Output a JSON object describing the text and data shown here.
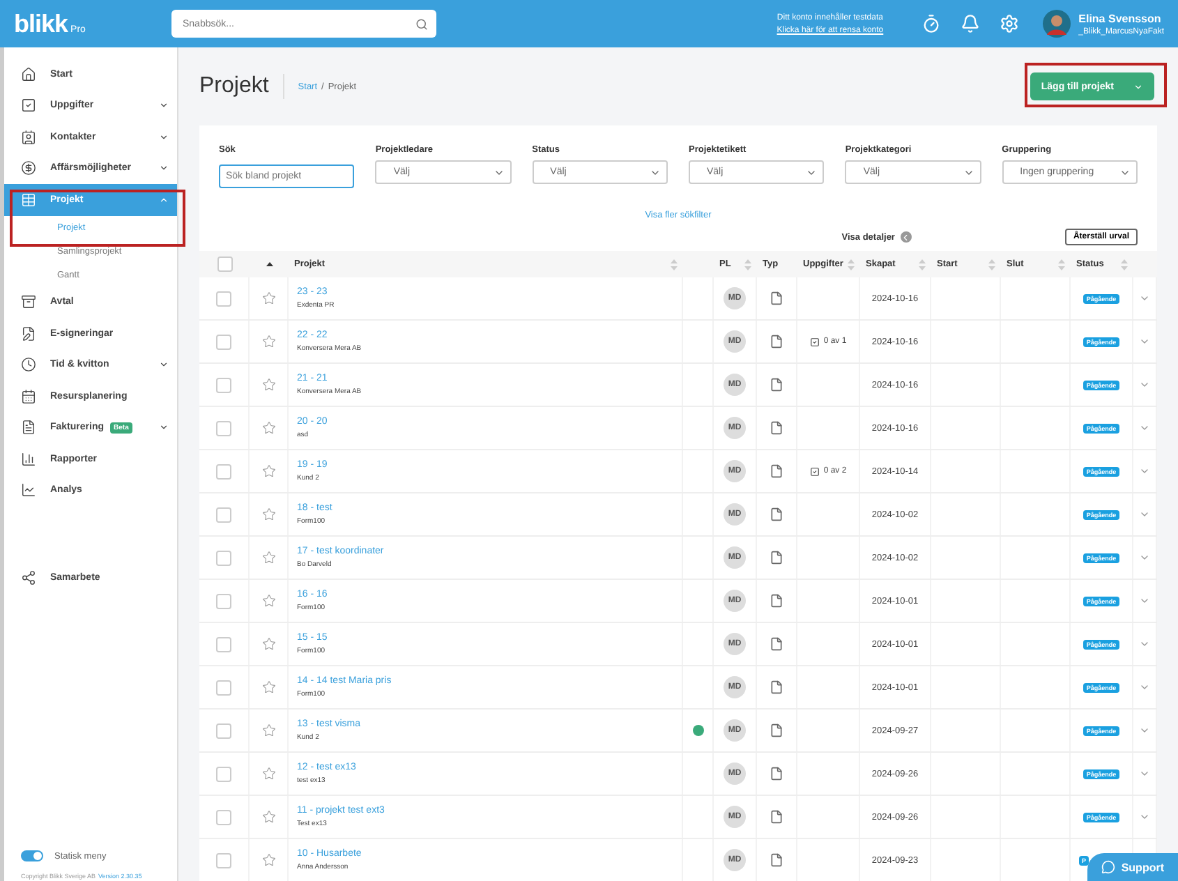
{
  "topbar": {
    "logo": "blikk",
    "logo_suffix": "Pro",
    "search": {
      "placeholder": "Snabbsök..."
    },
    "notice": "Ditt konto innehåller testdata",
    "notice_link": "Klicka här för att rensa konto",
    "user_name": "Elina Svensson",
    "user_account": "_Blikk_MarcusNyaFakt"
  },
  "sidebar": {
    "items": [
      {
        "label": "Start"
      },
      {
        "label": "Uppgifter",
        "expanded": false
      },
      {
        "label": "Kontakter",
        "expanded": false
      },
      {
        "label": "Affärsmöjligheter",
        "expanded": false
      },
      {
        "label": "Projekt",
        "expanded": true,
        "selected": true,
        "children": [
          {
            "label": "Projekt",
            "selected": true
          },
          {
            "label": "Samlingsprojekt",
            "selected": false
          },
          {
            "label": "Gantt",
            "selected": false
          }
        ]
      },
      {
        "label": "Avtal"
      },
      {
        "label": "E-signeringar"
      },
      {
        "label": "Tid & kvitton",
        "expanded": false
      },
      {
        "label": "Resursplanering"
      },
      {
        "label": "Fakturering",
        "badge": "Beta",
        "expanded": false
      },
      {
        "label": "Rapporter"
      },
      {
        "label": "Analys"
      }
    ],
    "bottom_items": [
      {
        "label": "Samarbete"
      }
    ],
    "toggle": {
      "label": "Statisk meny",
      "on": true
    },
    "footer": "Copyright Blikk Sverige AB",
    "version": "Version 2.30.35"
  },
  "page": {
    "title": "Projekt",
    "breadcrumb": [
      "Start",
      "Projekt"
    ],
    "breadcrumb_separator": "/",
    "add_button": "Lägg till projekt"
  },
  "filters": [
    {
      "label": "Sök",
      "kind": "text",
      "placeholder": "Sök bland projekt"
    },
    {
      "label": "Projektledare",
      "kind": "select",
      "value": "Välj"
    },
    {
      "label": "Status",
      "kind": "select",
      "value": "Välj"
    },
    {
      "label": "Projektetikett",
      "kind": "select",
      "value": "Välj"
    },
    {
      "label": "Projektkategori",
      "kind": "select",
      "value": "Välj"
    },
    {
      "label": "Gruppering",
      "kind": "select",
      "value": "Ingen gruppering"
    }
  ],
  "more_filters": "Visa fler sökfilter",
  "show_details": "Visa detaljer",
  "reset_button": "Återställ urval",
  "table": {
    "select_all_checked": false,
    "columns": [
      "Projekt",
      "PL",
      "Typ",
      "Uppgifter",
      "Skapat",
      "Start",
      "Slut",
      "Status"
    ],
    "rows": [
      {
        "checked": false,
        "name": "23 - 23",
        "client": "Exdenta PR",
        "pl": "MD",
        "created": "2024-10-16",
        "status": "Pågående"
      },
      {
        "checked": false,
        "name": "22 - 22",
        "client": "Konversera Mera AB",
        "pl": "MD",
        "tasks": "0 av 1",
        "created": "2024-10-16",
        "status": "Pågående"
      },
      {
        "checked": false,
        "name": "21 - 21",
        "client": "Konversera Mera AB",
        "pl": "MD",
        "created": "2024-10-16",
        "status": "Pågående"
      },
      {
        "checked": false,
        "name": "20 - 20",
        "client": "asd",
        "pl": "MD",
        "created": "2024-10-16",
        "status": "Pågående"
      },
      {
        "checked": false,
        "name": "19 - 19",
        "client": "Kund 2",
        "pl": "MD",
        "tasks": "0 av 2",
        "created": "2024-10-14",
        "status": "Pågående"
      },
      {
        "checked": false,
        "name": "18 - test",
        "client": "Form100",
        "pl": "MD",
        "created": "2024-10-02",
        "status": "Pågående"
      },
      {
        "checked": false,
        "name": "17 - test koordinater",
        "client": "Bo Darveld",
        "pl": "MD",
        "created": "2024-10-02",
        "status": "Pågående"
      },
      {
        "checked": false,
        "name": "16 - 16",
        "client": "Form100",
        "pl": "MD",
        "created": "2024-10-01",
        "status": "Pågående"
      },
      {
        "checked": false,
        "name": "15 - 15",
        "client": "Form100",
        "pl": "MD",
        "created": "2024-10-01",
        "status": "Pågående"
      },
      {
        "checked": false,
        "name": "14 - 14 test Maria pris",
        "client": "Form100",
        "pl": "MD",
        "created": "2024-10-01",
        "status": "Pågående"
      },
      {
        "checked": false,
        "name": "13 - test visma",
        "client": "Kund 2",
        "pl": "MD",
        "created": "2024-09-27",
        "status": "Pågående",
        "color": "#3aaa7a"
      },
      {
        "checked": false,
        "name": "12 - test ex13",
        "client": "test ex13",
        "pl": "MD",
        "created": "2024-09-26",
        "status": "Pågående"
      },
      {
        "checked": false,
        "name": "11 - projekt test ext3",
        "client": "Test ex13",
        "pl": "MD",
        "created": "2024-09-26",
        "status": "Pågående"
      },
      {
        "checked": false,
        "name": "10 - Husarbete",
        "client": "Anna Andersson",
        "pl": "MD",
        "created": "2024-09-23",
        "status": "P"
      }
    ]
  },
  "support_button": "Support"
}
